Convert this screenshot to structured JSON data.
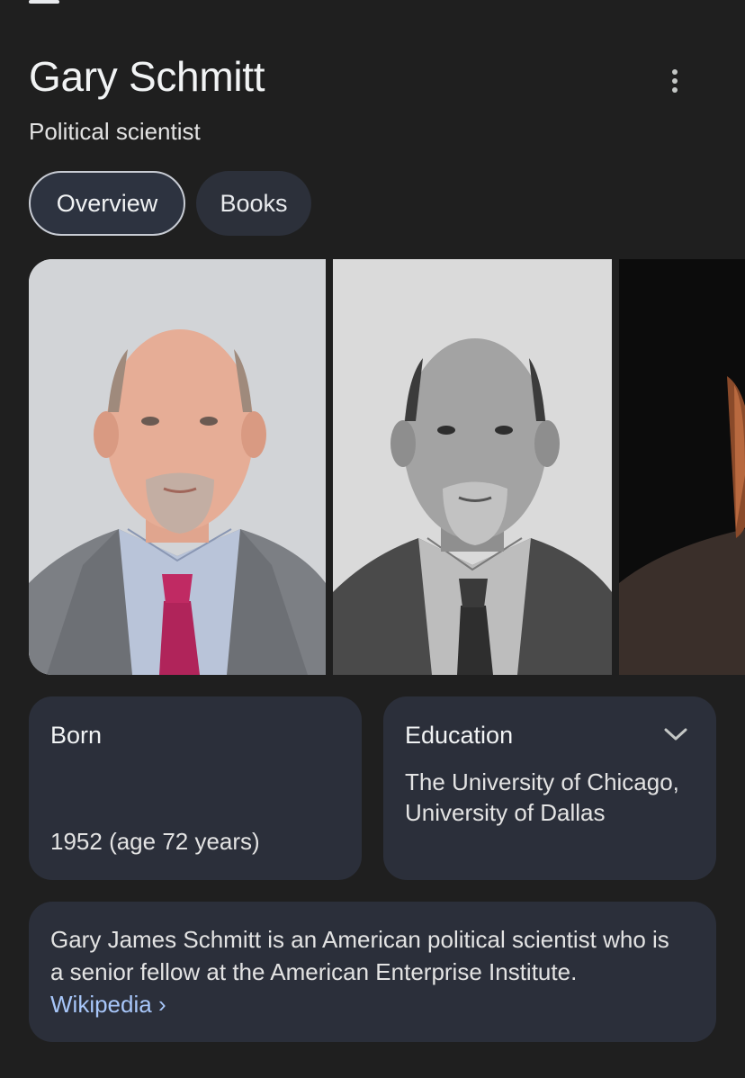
{
  "header": {
    "title": "Gary Schmitt",
    "subtitle": "Political scientist"
  },
  "tabs": [
    {
      "label": "Overview",
      "selected": true
    },
    {
      "label": "Books",
      "selected": false
    }
  ],
  "gallery": {
    "images": [
      {
        "description": "portrait-color"
      },
      {
        "description": "portrait-black-and-white"
      },
      {
        "description": "portrait-dark-partial"
      }
    ]
  },
  "facts": {
    "born": {
      "label": "Born",
      "value": "1952 (age 72 years)"
    },
    "education": {
      "label": "Education",
      "value": "The University of Chicago, University of Dallas"
    }
  },
  "description": {
    "text": "Gary James Schmitt is an American political scientist who is a senior fellow at the American Enterprise Institute.",
    "source_link": "Wikipedia",
    "source_arrow": "›"
  },
  "colors": {
    "background": "#1f1f1f",
    "card": "#2b2f3a",
    "link": "#a8c7fa",
    "text": "#e8eaed"
  },
  "icons": {
    "menu": "more-vert-icon",
    "expand": "chevron-down-icon"
  }
}
